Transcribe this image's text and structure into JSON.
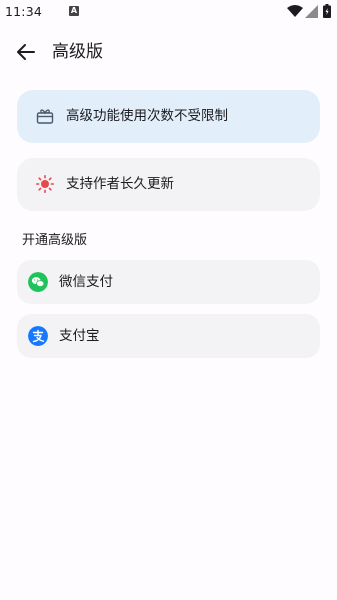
{
  "status_bar": {
    "time": "11:34",
    "notification_glyph": "A"
  },
  "app_bar": {
    "title": "高级版"
  },
  "features": [
    {
      "icon": "gift-icon",
      "label": "高级功能使用次数不受限制"
    },
    {
      "icon": "sun-icon",
      "label": "支持作者长久更新"
    }
  ],
  "section": {
    "title": "开通高级版"
  },
  "payments": [
    {
      "icon": "wechat-icon",
      "label": "微信支付"
    },
    {
      "icon": "alipay-icon",
      "label": "支付宝"
    }
  ],
  "colors": {
    "upgrade_card_bg": "#e2effb",
    "card_bg": "#f3f3f5",
    "sun": "#e5484d",
    "wechat": "#1fc35a",
    "alipay": "#1678ff"
  }
}
